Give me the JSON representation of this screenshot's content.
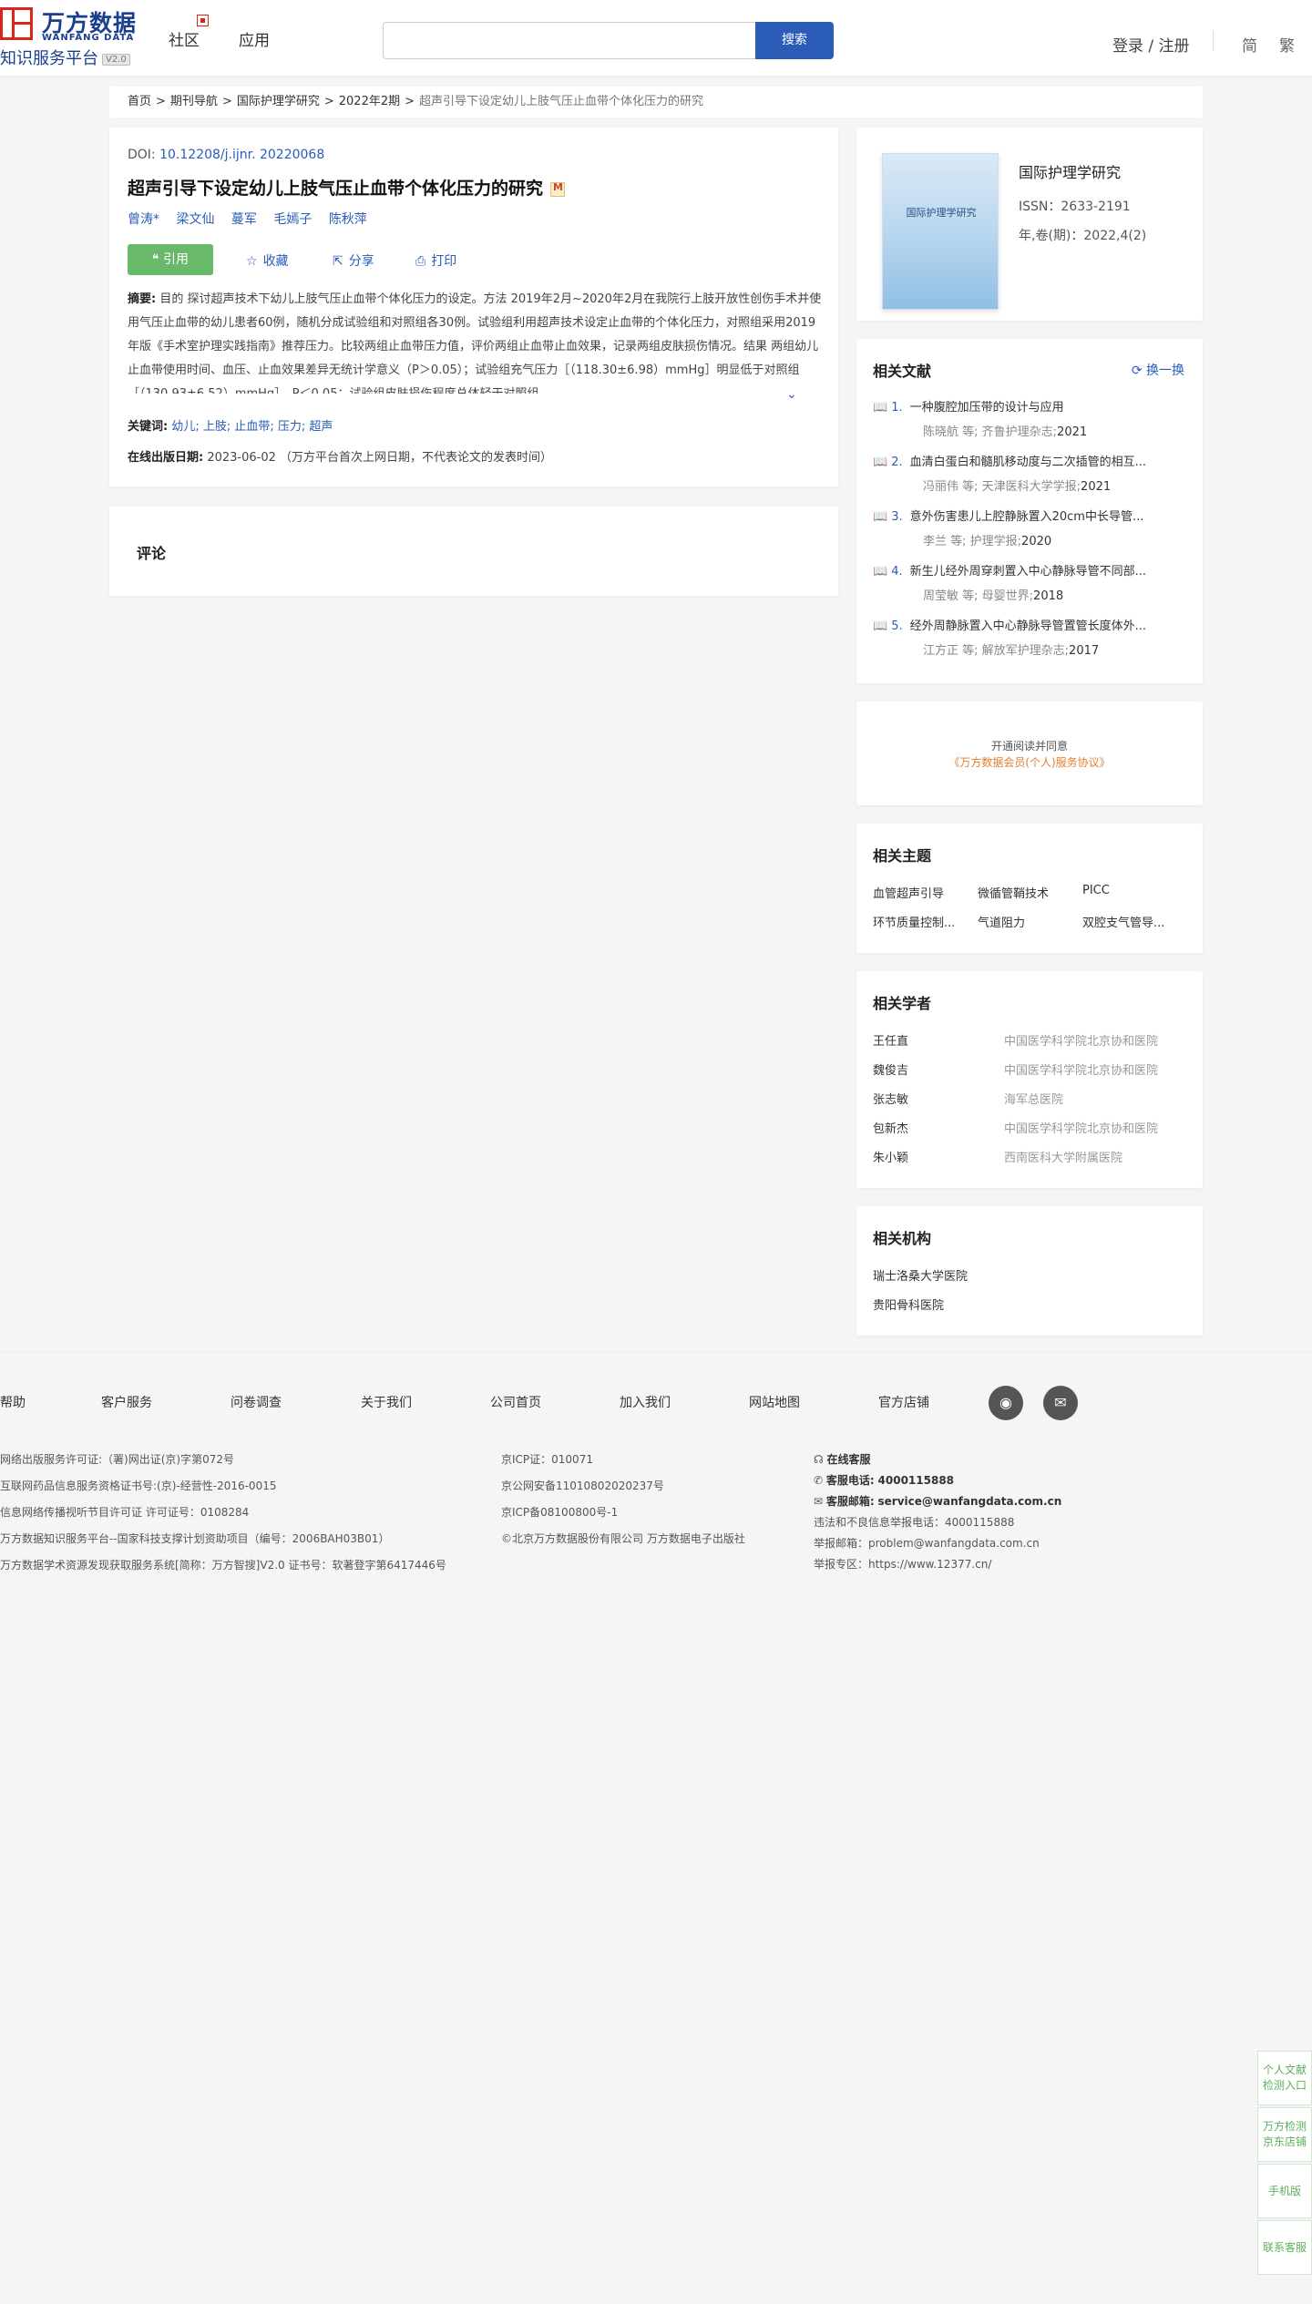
{
  "header": {
    "logo_cn": "万方数据",
    "logo_en": "WANFANG DATA",
    "logo_sub": "知识服务平台",
    "logo_ver": "V2.0",
    "nav": [
      "社区",
      "应用"
    ],
    "search_placeholder": "",
    "search_button": "搜索",
    "login": "登录 / 注册",
    "lang_simplified": "简",
    "lang_traditional": "繁"
  },
  "breadcrumb": {
    "items": [
      "首页",
      "期刊导航",
      "国际护理学研究",
      "2022年2期"
    ],
    "current": "超声引导下设定幼儿上肢气压止血带个体化压力的研究"
  },
  "article": {
    "doi_label": "DOI:",
    "doi": "10.12208/j.ijnr. 20220068",
    "title": "超声引导下设定幼儿上肢气压止血带个体化压力的研究",
    "authors": [
      "曾涛*",
      "梁文仙",
      "蔓军",
      "毛嫣子",
      "陈秋萍"
    ],
    "actions": {
      "cite": "引用",
      "favorite": "收藏",
      "share": "分享",
      "print": "打印"
    },
    "abstract_label": "摘要:",
    "abstract": "目的 探讨超声技术下幼儿上肢气压止血带个体化压力的设定。方法 2019年2月~2020年2月在我院行上肢开放性创伤手术并使用气压止血带的幼儿患者60例，随机分成试验组和对照组各30例。试验组利用超声技术设定止血带的个体化压力，对照组采用2019年版《手术室护理实践指南》推荐压力。比较两组止血带压力值，评价两组止血带止血效果，记录两组皮肤损伤情况。结果 两组幼儿止血带使用时间、血压、止血效果差异无统计学意义（P＞0.05）；试验组充气压力［（118.30±6.98）mmHg］明显低于对照组［（130.93±6.52）mmHg］，P＜0.05；试验组皮肤损伤程度总体轻于对照组...",
    "keywords_label": "关键词:",
    "keywords": "幼儿; 上肢; 止血带; 压力; 超声",
    "online_label": "在线出版日期:",
    "online_date": "2023-06-02",
    "online_note": "（万方平台首次上网日期，不代表论文的发表时间）"
  },
  "comment": {
    "title": "评论"
  },
  "journal": {
    "cover_text": "国际护理学研究",
    "name": "国际护理学研究",
    "issn": "ISSN：2633-2191",
    "volume": "年,卷(期)：2022,4(2)"
  },
  "related_literature": {
    "title": "相关文献",
    "refresh": "换一换",
    "items": [
      {
        "num": "1.",
        "title": "一种腹腔加压带的设计与应用",
        "authors": "陈晓航  等;",
        "source": "齐鲁护理杂志;",
        "year": "2021"
      },
      {
        "num": "2.",
        "title": "血清白蛋白和髓肌移动度与二次插管的相互...",
        "authors": "冯丽伟  等;",
        "source": "天津医科大学学报;",
        "year": "2021"
      },
      {
        "num": "3.",
        "title": "意外伤害患儿上腔静脉置入20cm中长导管...",
        "authors": "李兰  等;",
        "source": "护理学报;",
        "year": "2020"
      },
      {
        "num": "4.",
        "title": "新生儿经外周穿刺置入中心静脉导管不同部...",
        "authors": "周莹敏  等;",
        "source": "母婴世界;",
        "year": "2018"
      },
      {
        "num": "5.",
        "title": "经外周静脉置入中心静脉导管置管长度体外...",
        "authors": "江方正  等;",
        "source": "解放军护理杂志;",
        "year": "2017"
      }
    ]
  },
  "agreement": {
    "text": "开通阅读并同意",
    "link": "《万方数据会员(个人)服务协议》"
  },
  "related_topics": {
    "title": "相关主题",
    "items": [
      "血管超声引导",
      "微循管鞘技术",
      "PICC",
      "环节质量控制...",
      "气道阻力",
      "双腔支气管导..."
    ]
  },
  "related_scholars": {
    "title": "相关学者",
    "items": [
      {
        "name": "王任直",
        "org": "中国医学科学院北京协和医院"
      },
      {
        "name": "魏俊吉",
        "org": "中国医学科学院北京协和医院"
      },
      {
        "name": "张志敏",
        "org": "海军总医院"
      },
      {
        "name": "包新杰",
        "org": "中国医学科学院北京协和医院"
      },
      {
        "name": "朱小颖",
        "org": "西南医科大学附属医院"
      }
    ]
  },
  "related_orgs": {
    "title": "相关机构",
    "items": [
      "瑞士洛桑大学医院",
      "贵阳骨科医院"
    ]
  },
  "footer": {
    "links": [
      "帮助",
      "客户服务",
      "问卷调查",
      "关于我们",
      "公司首页",
      "加入我们",
      "网站地图",
      "官方店铺"
    ],
    "col1": [
      "网络出版服务许可证:（署)网出证(京)字第072号",
      "互联网药品信息服务资格证书号:(京)-经营性-2016-0015",
      "信息网络传播视听节目许可证 许可证号：0108284",
      "万方数据知识服务平台--国家科技支撑计划资助项目（编号：2006BAH03B01）",
      "万方数据学术资源发现获取服务系统[简称：万方智搜]V2.0 证书号：软著登字第6417446号"
    ],
    "col2": [
      "京ICP证：010071",
      "京公网安备11010802020237号",
      "京ICP备08100800号-1",
      "©北京万方数据股份有限公司 万方数据电子出版社"
    ],
    "online_service": "在线客服",
    "phone_label": "客服电话:",
    "phone": "4000115888",
    "email_label": "客服邮箱:",
    "email": "service@wanfangdata.com.cn",
    "report_phone": "违法和不良信息举报电话：4000115888",
    "report_email": "举报邮箱：problem@wanfangdata.com.cn",
    "report_site": "举报专区：https://www.12377.cn/"
  },
  "float_buttons": [
    "个人文献检测入口",
    "万方检测京东店铺",
    "手机版",
    "联系客服"
  ]
}
